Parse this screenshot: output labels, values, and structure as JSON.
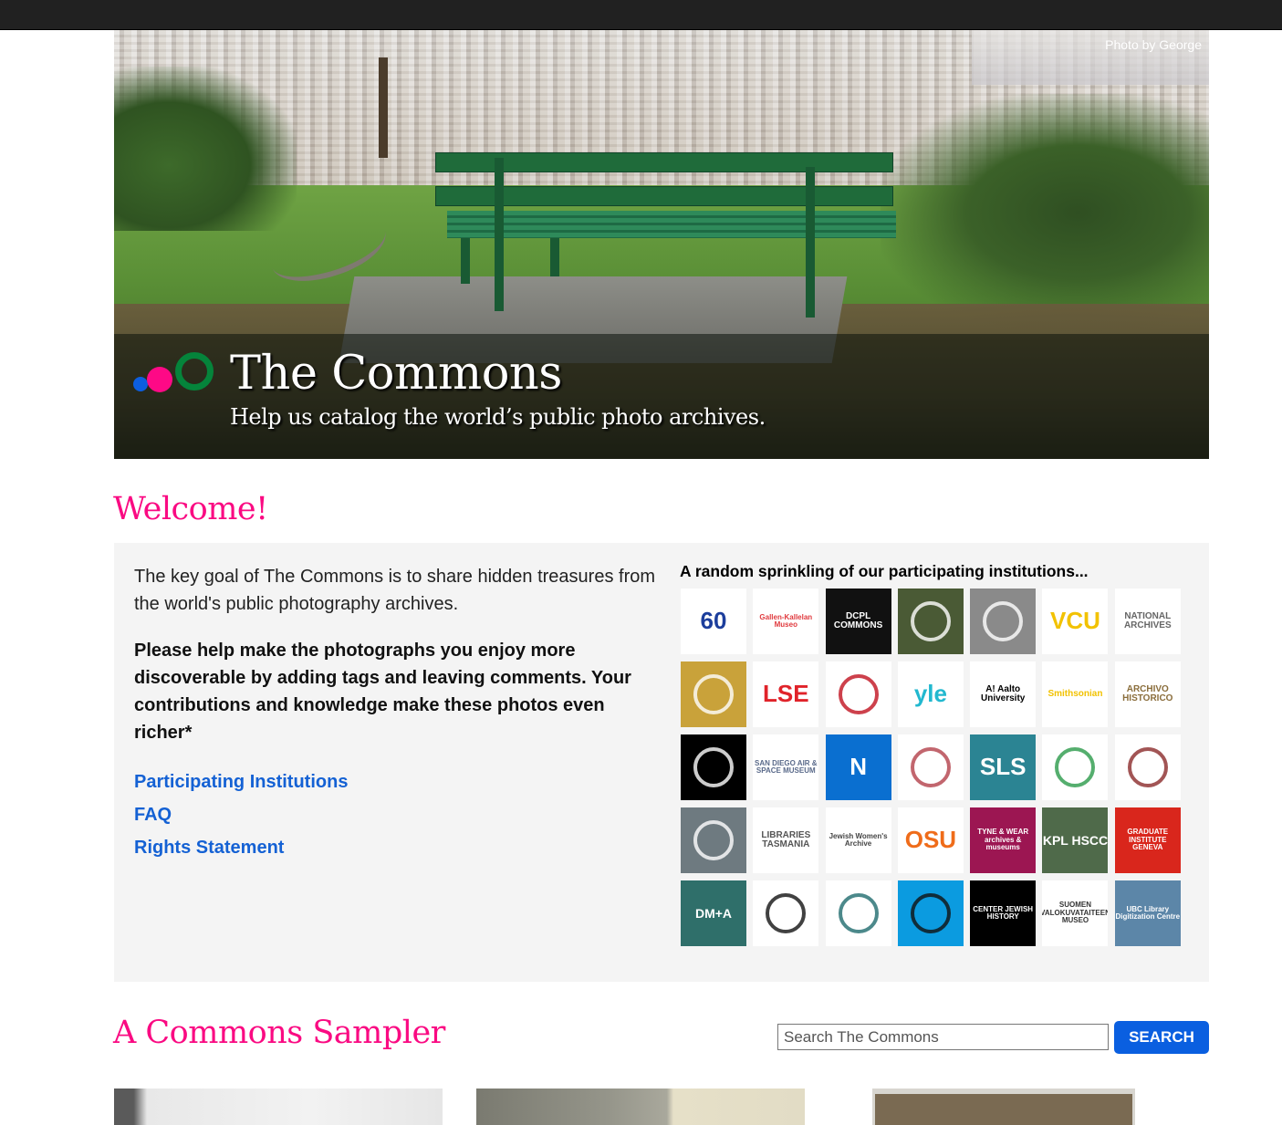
{
  "hero": {
    "photo_credit": "Photo by George",
    "title": "The Commons",
    "subtitle": "Help us catalog the world’s public photo archives.",
    "logo_colors": {
      "blue": "#0c5ee0",
      "pink": "#fe0986",
      "green": "#05843b"
    }
  },
  "welcome": {
    "title": "Welcome!",
    "intro": "The key goal of The Commons is to share hidden treasures from the world's public photography archives.",
    "callout": "Please help make the photographs you enjoy more discoverable by adding tags and leaving comments. Your contributions and knowledge make these photos even richer*",
    "links": [
      {
        "label": "Participating Institutions"
      },
      {
        "label": "FAQ"
      },
      {
        "label": "Rights Statement"
      }
    ]
  },
  "institutions": {
    "heading": "A random sprinkling of our participating institutions...",
    "tiles": [
      {
        "name": "60-anniversary-seal",
        "text": "60",
        "bg": "#ffffff",
        "fg": "#1c3e9c"
      },
      {
        "name": "gallen-kallelan-museo",
        "text": "Gallen-Kallelan Museo",
        "bg": "#ffffff",
        "fg": "#e03a3e"
      },
      {
        "name": "dcpl-commons",
        "text": "DCPL COMMONS",
        "bg": "#111111",
        "fg": "#ffffff"
      },
      {
        "name": "forest-cabin-photo",
        "text": "",
        "bg": "#4a5a35",
        "fg": "#ffffff"
      },
      {
        "name": "portrait-photo",
        "text": "",
        "bg": "#8a8a8a",
        "fg": "#ffffff"
      },
      {
        "name": "virginia-commonwealth-university",
        "text": "VCU",
        "bg": "#ffffff",
        "fg": "#f2c200"
      },
      {
        "name": "national-archives",
        "text": "NATIONAL ARCHIVES",
        "bg": "#ffffff",
        "fg": "#666666"
      },
      {
        "name": "golden-handwriting",
        "text": "",
        "bg": "#c9a23a",
        "fg": "#ffffff"
      },
      {
        "name": "lse",
        "text": "LSE",
        "bg": "#ffffff",
        "fg": "#e0232a"
      },
      {
        "name": "red-dots-logo",
        "text": "",
        "bg": "#ffffff",
        "fg": "#c1121f"
      },
      {
        "name": "yle",
        "text": "yle",
        "bg": "#ffffff",
        "fg": "#22b8cf"
      },
      {
        "name": "aalto-university",
        "text": "A! Aalto University",
        "bg": "#ffffff",
        "fg": "#000000"
      },
      {
        "name": "smithsonian",
        "text": "Smithsonian",
        "bg": "#ffffff",
        "fg": "#f2c200"
      },
      {
        "name": "archivo-historico",
        "text": "ARCHIVO HISTORICO",
        "bg": "#ffffff",
        "fg": "#8a6d3b"
      },
      {
        "name": "black-lines-logo",
        "text": "",
        "bg": "#000000",
        "fg": "#ffffff"
      },
      {
        "name": "san-diego-air-space-museum",
        "text": "SAN DIEGO AIR & SPACE MUSEUM",
        "bg": "#ffffff",
        "fg": "#5a6a8a"
      },
      {
        "name": "compass-n-logo",
        "text": "N",
        "bg": "#0a6fd0",
        "fg": "#ffffff"
      },
      {
        "name": "cornell-university",
        "text": "",
        "bg": "#ffffff",
        "fg": "#b3404a"
      },
      {
        "name": "sls",
        "text": "SLS",
        "bg": "#2b8493",
        "fg": "#ffffff"
      },
      {
        "name": "dove-logo",
        "text": "",
        "bg": "#ffffff",
        "fg": "#2a9a4a"
      },
      {
        "name": "compass-rose",
        "text": "",
        "bg": "#ffffff",
        "fg": "#8b2b2b"
      },
      {
        "name": "building-photo",
        "text": "",
        "bg": "#6e7a80",
        "fg": "#ffffff"
      },
      {
        "name": "libraries-tasmania",
        "text": "LIBRARIES TASMANIA",
        "bg": "#ffffff",
        "fg": "#555555"
      },
      {
        "name": "jewish-womens-archive",
        "text": "Jewish Women's Archive",
        "bg": "#ffffff",
        "fg": "#444444"
      },
      {
        "name": "oregon-state-university",
        "text": "OSU",
        "bg": "#ffffff",
        "fg": "#ef6c1a"
      },
      {
        "name": "tyne-wear-archives-museums",
        "text": "TYNE & WEAR archives & museums",
        "bg": "#9c1652",
        "fg": "#ffffff"
      },
      {
        "name": "kpl-hscc",
        "text": "KPL HSCC",
        "bg": "#4f6a4a",
        "fg": "#ffffff"
      },
      {
        "name": "graduate-institute-geneva",
        "text": "GRADUATE INSTITUTE GENEVA",
        "bg": "#d9261c",
        "fg": "#ffffff"
      },
      {
        "name": "dma",
        "text": "DM+A",
        "bg": "#2f6f6a",
        "fg": "#ffffff"
      },
      {
        "name": "pioneer-museum-archives",
        "text": "",
        "bg": "#ffffff",
        "fg": "#111111"
      },
      {
        "name": "teal-rosette",
        "text": "",
        "bg": "#ffffff",
        "fg": "#1f6b6e"
      },
      {
        "name": "train-horse-logo",
        "text": "",
        "bg": "#0b9be0",
        "fg": "#111111"
      },
      {
        "name": "center-for-jewish-history",
        "text": "CENTER JEWISH HISTORY",
        "bg": "#000000",
        "fg": "#ffffff"
      },
      {
        "name": "suomen-valokuvataiteen-museo",
        "text": "SUOMEN VALOKUVATAITEEN MUSEO",
        "bg": "#ffffff",
        "fg": "#333333"
      },
      {
        "name": "ubc-library-digitization-centre",
        "text": "UBC Library Digitization Centre",
        "bg": "#5c86a8",
        "fg": "#ffffff"
      }
    ]
  },
  "sampler": {
    "title": "A Commons Sampler",
    "search_placeholder": "Search The Commons",
    "search_value": "",
    "search_button": "SEARCH"
  }
}
